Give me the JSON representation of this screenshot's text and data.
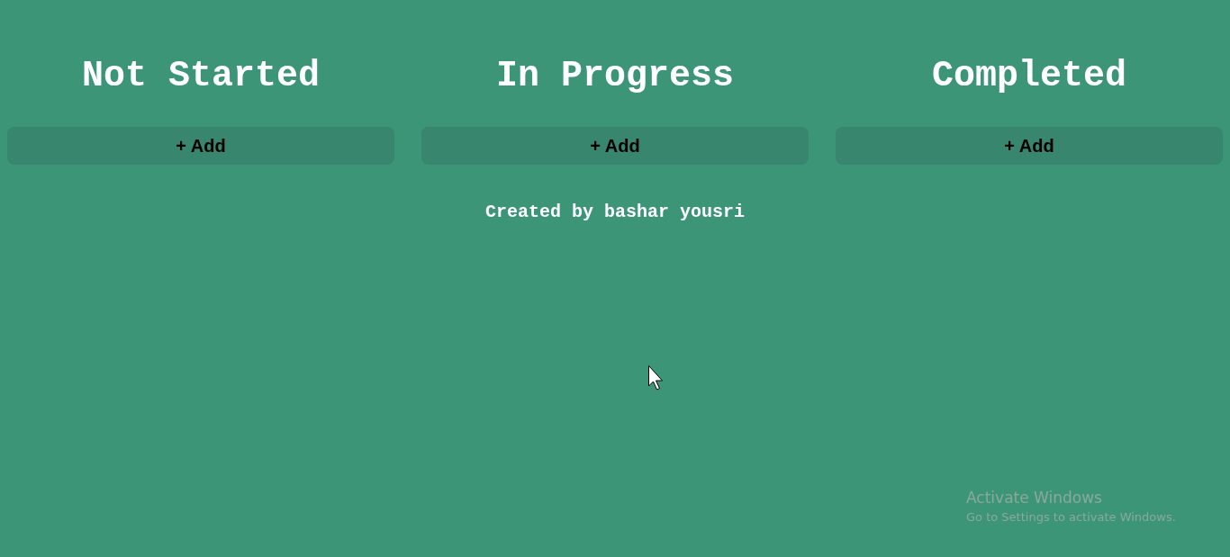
{
  "columns": [
    {
      "title": "Not Started",
      "add_button": "+ Add"
    },
    {
      "title": "In Progress",
      "add_button": "+ Add"
    },
    {
      "title": "Completed",
      "add_button": "+ Add"
    }
  ],
  "footer": "Created by bashar yousri",
  "activation_notice": {
    "title": "Activate Windows",
    "subtitle": "Go to Settings to activate Windows."
  }
}
